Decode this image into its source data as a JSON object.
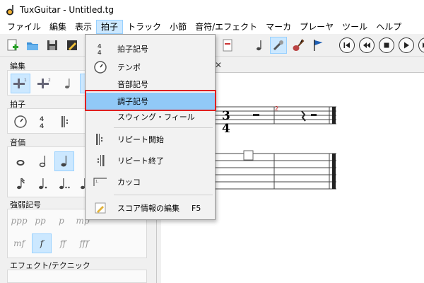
{
  "window": {
    "title": "TuxGuitar - Untitled.tg"
  },
  "menubar": {
    "items": [
      "ファイル",
      "編集",
      "表示",
      "拍子",
      "トラック",
      "小節",
      "音符/エフェクト",
      "マーカ",
      "プレーヤ",
      "ツール",
      "ヘルプ"
    ],
    "active": "拍子"
  },
  "dropdown": {
    "items": [
      {
        "label": "拍子記号",
        "icon": "time-signature-icon"
      },
      {
        "label": "テンポ",
        "icon": "metronome-icon"
      },
      {
        "label": "音部記号",
        "icon": ""
      },
      {
        "label": "調子記号",
        "icon": "",
        "highlighted": true
      },
      {
        "label": "スウィング・フィール",
        "icon": ""
      },
      {
        "label": "リピート開始",
        "icon": "repeat-open-icon"
      },
      {
        "label": "リピート終了",
        "icon": "repeat-close-icon"
      },
      {
        "label": "カッコ",
        "icon": "alternate-ending-icon"
      },
      {
        "label": "スコア情報の編集",
        "icon": "pencil-icon",
        "shortcut": "F5"
      }
    ]
  },
  "panel": {
    "sections": {
      "edit": "編集",
      "time": "拍子",
      "duration": "音価",
      "dynamics": "強弱記号",
      "effects": "エフェクト/テクニック"
    },
    "dynamics": [
      "ppp",
      "pp",
      "p",
      "mp",
      "mf",
      "f",
      "ff",
      "fff"
    ],
    "selected_dynamic": "f"
  },
  "score": {
    "time_signature": {
      "top": "3",
      "bottom": "4"
    },
    "measure_number": "2"
  },
  "colors": {
    "accent": "#cce8ff",
    "highlight": "#91c9f7",
    "annotation": "#e02020"
  }
}
